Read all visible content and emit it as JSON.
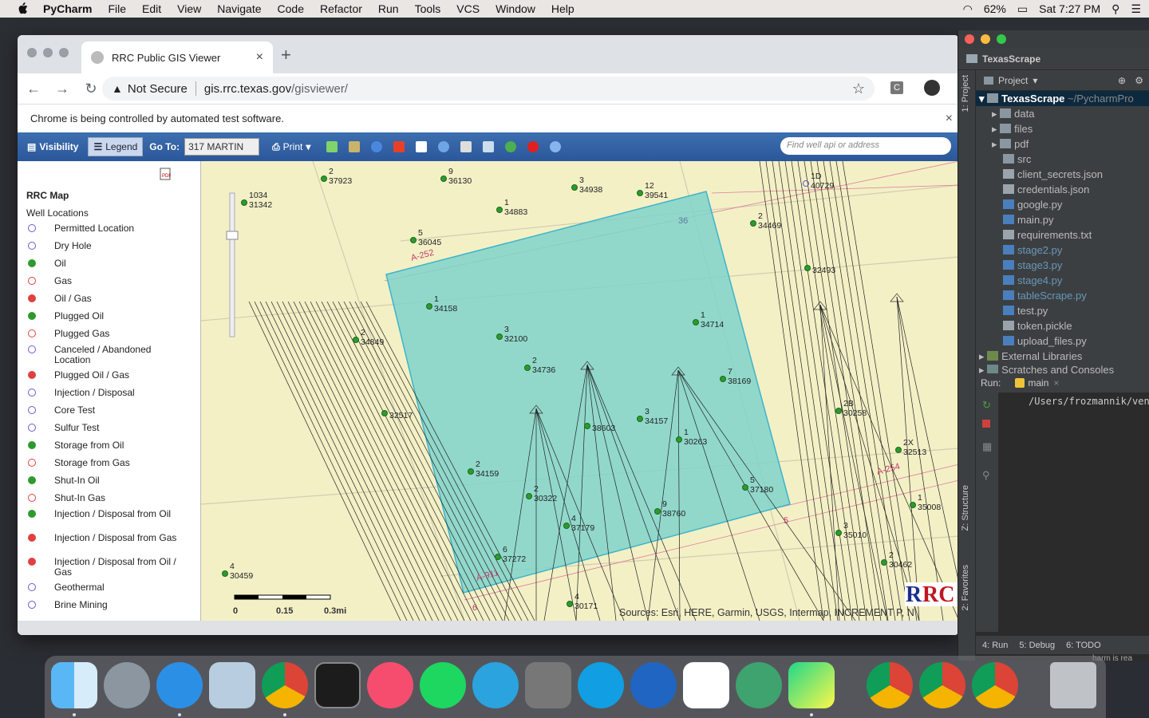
{
  "menubar": {
    "app": "PyCharm",
    "items": [
      "File",
      "Edit",
      "View",
      "Navigate",
      "Code",
      "Refactor",
      "Run",
      "Tools",
      "VCS",
      "Window",
      "Help"
    ],
    "battery": "62%",
    "datetime": "Sat 7:27 PM"
  },
  "chrome": {
    "tab_title": "RRC Public GIS Viewer",
    "security": "Not Secure",
    "url_host": "gis.rrc.texas.gov",
    "url_path": "/gisviewer/",
    "infobar": "Chrome is being controlled by automated test software."
  },
  "gis_toolbar": {
    "visibility": "Visibility",
    "legend": "Legend",
    "goto_label": "Go To:",
    "goto_value": "317 MARTIN",
    "print": "Print",
    "search_placeholder": "Find well api or address"
  },
  "legend": {
    "title": "RRC Map",
    "section": "Well Locations",
    "items": [
      "Permitted Location",
      "Dry Hole",
      "Oil",
      "Gas",
      "Oil / Gas",
      "Plugged Oil",
      "Plugged Gas",
      "Canceled / Abandoned Location",
      "Plugged Oil / Gas",
      "Injection / Disposal",
      "Core Test",
      "Sulfur Test",
      "Storage from Oil",
      "Storage from Gas",
      "Shut-In Oil",
      "Shut-In Gas",
      "Injection / Disposal from Oil",
      "Injection / Disposal from Gas",
      "Injection / Disposal from Oil / Gas",
      "Geothermal",
      "Brine Mining"
    ]
  },
  "map": {
    "wells": [
      {
        "n": "2",
        "id": "37923"
      },
      {
        "n": "9",
        "id": "36130"
      },
      {
        "n": "3",
        "id": "34938"
      },
      {
        "n": "12",
        "id": "39541"
      },
      {
        "n": "1D",
        "id": "40729"
      },
      {
        "n": "1",
        "id": "34883"
      },
      {
        "n": "2",
        "id": "34469"
      },
      {
        "n": "5",
        "id": "36045"
      },
      {
        "n": "1",
        "id": "34158"
      },
      {
        "n": "1",
        "id": "34714"
      },
      {
        "n": "3",
        "id": "32100"
      },
      {
        "n": "2",
        "id": "34736"
      },
      {
        "n": "7",
        "id": "38169"
      },
      {
        "n": "3",
        "id": "34157"
      },
      {
        "n": "1",
        "id": "30263"
      },
      {
        "n": "2",
        "id": "34159"
      },
      {
        "n": "5",
        "id": "37180"
      },
      {
        "n": "2",
        "id": "30322"
      },
      {
        "n": "9",
        "id": "38760"
      },
      {
        "n": "4",
        "id": "37179"
      },
      {
        "n": "6",
        "id": "37272"
      },
      {
        "n": "2B",
        "id": "30258"
      },
      {
        "n": "2X",
        "id": "32513"
      },
      {
        "n": "1",
        "id": "35008"
      },
      {
        "n": "3",
        "id": "35010"
      },
      {
        "n": "2",
        "id": "30462"
      },
      {
        "n": "4",
        "id": "30459"
      },
      {
        "n": "4",
        "id": "30171"
      },
      {
        "n": "",
        "id": "32493"
      },
      {
        "n": "1034",
        "id": "31342"
      },
      {
        "n": "",
        "id": "38603"
      },
      {
        "n": "",
        "id": "32517"
      },
      {
        "n": "2",
        "id": "34849"
      }
    ],
    "lease_labels": [
      "A-252",
      "A-254",
      "A-911",
      "36",
      "5",
      "6"
    ],
    "scale": [
      "0",
      "0.15",
      "0.3mi"
    ],
    "attribution": "Sources: Esri, HERE, Garmin, USGS, Intermap, INCREMENT P, N"
  },
  "pycharm": {
    "project": "TexasScrape",
    "project_label": "Project",
    "root": "TexasScrape",
    "root_path": "~/PycharmPro",
    "files": [
      "data",
      "files",
      "pdf",
      "src",
      "client_secrets.json",
      "credentials.json",
      "google.py",
      "main.py",
      "requirements.txt",
      "stage2.py",
      "stage3.py",
      "stage4.py",
      "tableScrape.py",
      "test.py",
      "token.pickle",
      "upload_files.py"
    ],
    "external": "External Libraries",
    "scratches": "Scratches and Consoles",
    "run_label": "Run:",
    "run_tab": "main",
    "console": "/Users/frozmannik/venv",
    "side_project": "1: Project",
    "side_structure": "Z: Structure",
    "side_favorites": "2: Favorites",
    "bottom": [
      "4: Run",
      "5: Debug",
      "6: TODO"
    ],
    "status": "harm is rea"
  }
}
